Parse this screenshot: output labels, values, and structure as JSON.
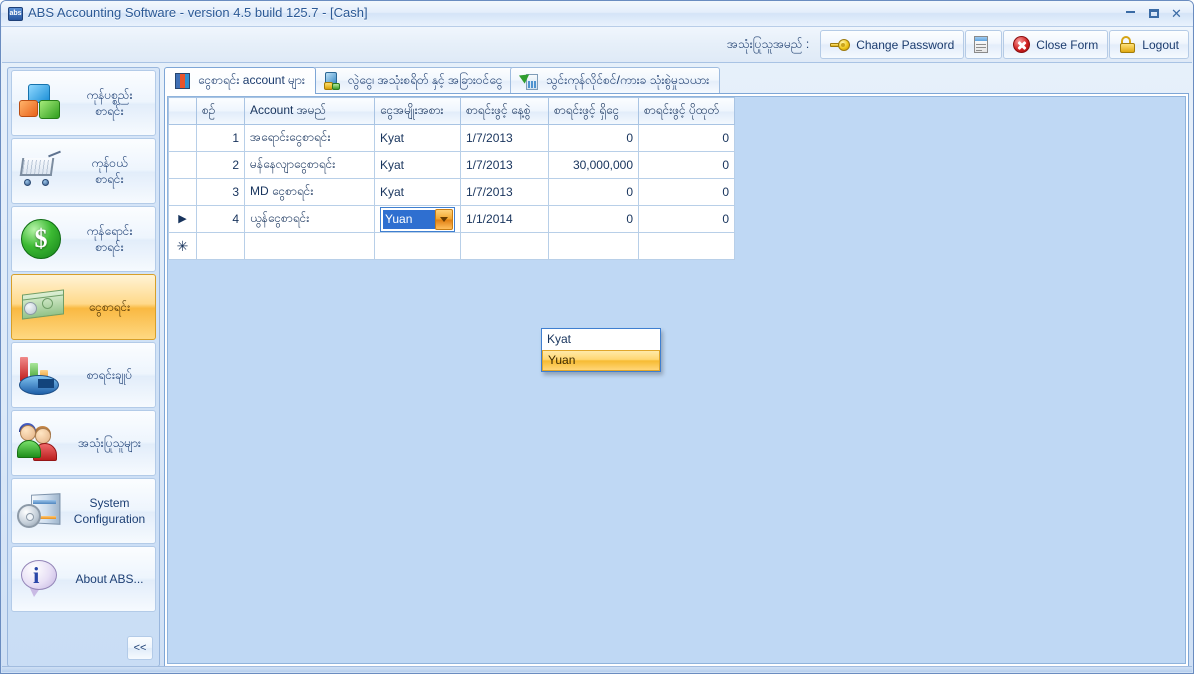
{
  "window": {
    "title": "ABS Accounting Software - version 4.5 build 125.7 - [Cash]",
    "app_icon": "abs",
    "icon_name": "abs-app-icon",
    "minimize": "–",
    "maximize": "▭",
    "close": "✕"
  },
  "toolbar": {
    "user_label": "အသုံးပြုသူအမည် :",
    "change_password": "Change Password",
    "report_button": "",
    "close_form": "Close Form",
    "logout": "Logout"
  },
  "sidebar": {
    "items": [
      {
        "label_line1": "ကုန်ပစ္စည်း",
        "label_line2": "စာရင်း",
        "icon": "boxes-icon",
        "selected": false
      },
      {
        "label_line1": "ကုန်ဝယ်",
        "label_line2": "စာရင်း",
        "icon": "shopping-cart-icon",
        "selected": false
      },
      {
        "label_line1": "ကုန်ရောင်း",
        "label_line2": "စာရင်း",
        "icon": "dollar-coin-icon",
        "selected": false
      },
      {
        "label_line1": "ငွေစာရင်း",
        "label_line2": "",
        "icon": "cash-stack-icon",
        "selected": true
      },
      {
        "label_line1": "စာရင်းချုပ်",
        "label_line2": "",
        "icon": "bar-pie-chart-icon",
        "selected": false
      },
      {
        "label_line1": "အသုံးပြုသူများ",
        "label_line2": "",
        "icon": "users-icon",
        "selected": false
      },
      {
        "label_line1": "System",
        "label_line2": "Configuration",
        "icon": "system-gear-icon",
        "selected": false
      },
      {
        "label_line1": "About ABS...",
        "label_line2": "",
        "icon": "info-bubble-icon",
        "selected": false
      }
    ],
    "collapse_button": "<<"
  },
  "tabs": [
    {
      "label": "ငွေစာရင်း account များ",
      "icon": "ledger-book-icon",
      "active": true
    },
    {
      "label": "လွဲငွေ၊ အသုံးစရိတ် နှင့် အခြားဝင်ငွေ",
      "icon": "safe-coins-icon",
      "active": false
    },
    {
      "label": "သွင်းကုန်လိုင်စင်/ကားခ သုံးစွဲမှုသယား",
      "icon": "import-building-icon",
      "active": false
    }
  ],
  "grid": {
    "columns": [
      {
        "key": "rowhdr",
        "label": ""
      },
      {
        "key": "idx",
        "label": "စဉ်"
      },
      {
        "key": "name",
        "label": "Account အမည်"
      },
      {
        "key": "type",
        "label": "ငွေအမျိုးအစား"
      },
      {
        "key": "date",
        "label": "စာရင်းဖွင့် နေ့စွဲ"
      },
      {
        "key": "cash",
        "label": "စာရင်းဖွင့် ရှိငွေ"
      },
      {
        "key": "over",
        "label": "စာရင်းဖွင့် ပိုထုတ်"
      }
    ],
    "rows": [
      {
        "marker": "",
        "idx": "1",
        "name": "အရောင်းငွေစာရင်း",
        "type": "Kyat",
        "date": "1/7/2013",
        "cash": "0",
        "over": "0",
        "editing": false
      },
      {
        "marker": "",
        "idx": "2",
        "name": "မန်နေလျာငွေစာရင်း",
        "type": "Kyat",
        "date": "1/7/2013",
        "cash": "30,000,000",
        "over": "0",
        "editing": false
      },
      {
        "marker": "",
        "idx": "3",
        "name": "MD ငွေစာရင်း",
        "type": "Kyat",
        "date": "1/7/2013",
        "cash": "0",
        "over": "0",
        "editing": false
      },
      {
        "marker": "▶",
        "idx": "4",
        "name": "ယွန်ငွေစာရင်း",
        "type": "Yuan",
        "date": "1/1/2014",
        "cash": "0",
        "over": "0",
        "editing": true
      },
      {
        "marker": "✳",
        "idx": "",
        "name": "",
        "type": "",
        "date": "",
        "cash": "",
        "over": "",
        "editing": false
      }
    ]
  },
  "dropdown": {
    "open": true,
    "options": [
      {
        "label": "Kyat",
        "selected": false
      },
      {
        "label": "Yuan",
        "selected": true
      }
    ]
  },
  "colors": {
    "titlebar_text": "#2c5a96",
    "grid_back": "#bfd8f4",
    "selection_blue": "#2f6fd0",
    "highlight_orange": "#f6bb33",
    "sidebar_selected": "#f9b942"
  }
}
